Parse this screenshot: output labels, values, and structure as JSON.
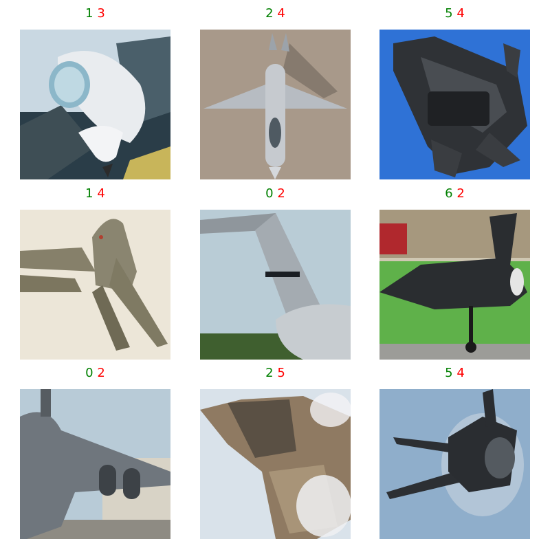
{
  "grid": {
    "tiles": [
      {
        "true_label": "1",
        "pred_label": "3",
        "subject": "white fighter jet nose and canopy on ramp"
      },
      {
        "true_label": "2",
        "pred_label": "4",
        "subject": "grey twin-tail jet seen from above on tarmac"
      },
      {
        "true_label": "5",
        "pred_label": "4",
        "subject": "dark stealth fighter with open weapons bay against blue sky"
      },
      {
        "true_label": "1",
        "pred_label": "4",
        "subject": "tan swept-wing fighter in flight against pale sky"
      },
      {
        "true_label": "0",
        "pred_label": "2",
        "subject": "grey transport aircraft tail fin against sky"
      },
      {
        "true_label": "6",
        "pred_label": "2",
        "subject": "black stealth jet on grass field near buildings"
      },
      {
        "true_label": "0",
        "pred_label": "2",
        "subject": "grey cargo aircraft taxiing near hangar"
      },
      {
        "true_label": "2",
        "pred_label": "5",
        "subject": "camouflaged fighter with vapor in flight"
      },
      {
        "true_label": "5",
        "pred_label": "4",
        "subject": "dark stealth jet with vapor cone against grey-blue sky"
      }
    ]
  },
  "colors": {
    "true_label": "#008000",
    "pred_label": "#ff0000"
  }
}
